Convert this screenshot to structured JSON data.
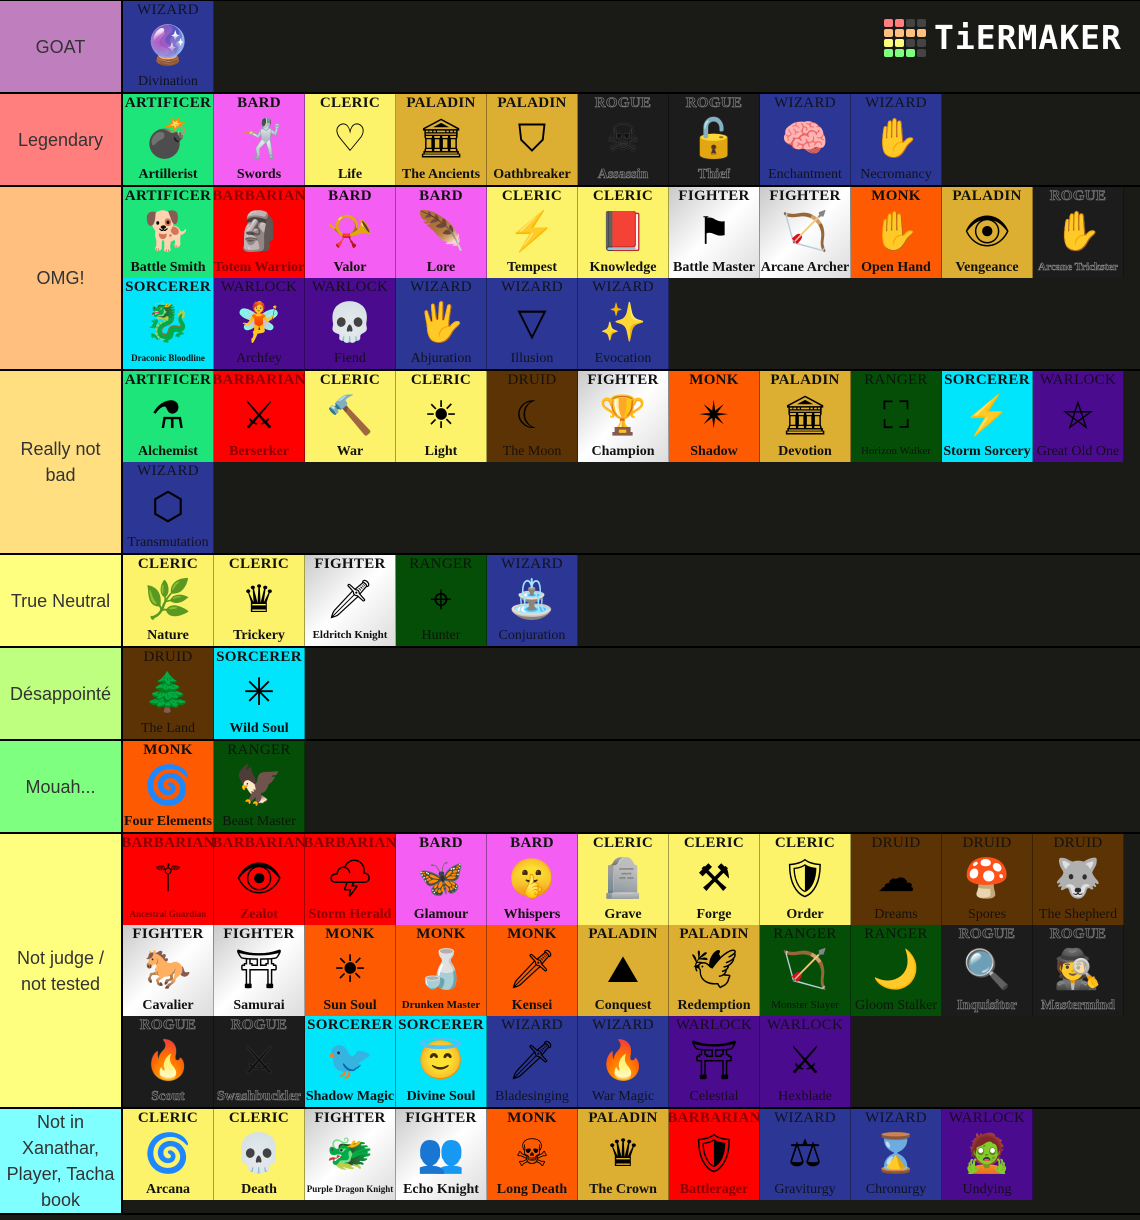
{
  "logo": {
    "text": "TiERMAKER",
    "grid_colors": [
      "#ff7f7f",
      "#ff7f7f",
      "#444",
      "#444",
      "#ffbf7f",
      "#ffbf7f",
      "#ffbf7f",
      "#ffbf7f",
      "#ffff7f",
      "#ffff7f",
      "#444",
      "#444",
      "#7fff7f",
      "#7fff7f",
      "#7fff7f",
      "#444"
    ]
  },
  "tiers": [
    {
      "label": "GOAT",
      "color": "#bf7fbf",
      "items": [
        {
          "class": "WIZARD",
          "sub": "Divination",
          "icon": "crystal-ball-icon",
          "glyph": "🔮"
        }
      ]
    },
    {
      "label": "Legendary",
      "color": "#ff7f7f",
      "items": [
        {
          "class": "ARTIFICER",
          "sub": "Artillerist",
          "icon": "cannon-icon",
          "glyph": "💣"
        },
        {
          "class": "BARD",
          "sub": "Swords",
          "icon": "rapier-icon",
          "glyph": "🤺"
        },
        {
          "class": "CLERIC",
          "sub": "Life",
          "icon": "heart-hands-icon",
          "glyph": "♡"
        },
        {
          "class": "PALADIN",
          "sub": "The Ancients",
          "icon": "pillar-icon",
          "glyph": "🏛"
        },
        {
          "class": "PALADIN",
          "sub": "Oathbreaker",
          "icon": "broken-shield-icon",
          "glyph": "⛉"
        },
        {
          "class": "ROGUE",
          "sub": "Assassin",
          "icon": "poison-bottle-icon",
          "glyph": "☠"
        },
        {
          "class": "ROGUE",
          "sub": "Thief",
          "icon": "broken-lock-icon",
          "glyph": "🔓"
        },
        {
          "class": "WIZARD",
          "sub": "Enchantment",
          "icon": "brain-head-icon",
          "glyph": "🧠"
        },
        {
          "class": "WIZARD",
          "sub": "Necromancy",
          "icon": "zombie-hand-icon",
          "glyph": "✋"
        }
      ]
    },
    {
      "label": "OMG!",
      "color": "#ffbf7f",
      "items": [
        {
          "class": "ARTIFICER",
          "sub": "Battle Smith",
          "icon": "steel-defender-icon",
          "glyph": "🐕"
        },
        {
          "class": "BARBARIAN",
          "sub": "Totem Warrior",
          "icon": "totem-icon",
          "glyph": "🗿"
        },
        {
          "class": "BARD",
          "sub": "Valor",
          "icon": "horn-icon",
          "glyph": "📯"
        },
        {
          "class": "BARD",
          "sub": "Lore",
          "icon": "quill-icon",
          "glyph": "🪶"
        },
        {
          "class": "CLERIC",
          "sub": "Tempest",
          "icon": "lightning-shield-icon",
          "glyph": "⚡"
        },
        {
          "class": "CLERIC",
          "sub": "Knowledge",
          "icon": "book-icon",
          "glyph": "📕"
        },
        {
          "class": "FIGHTER",
          "sub": "Battle Master",
          "icon": "banner-icon",
          "glyph": "⚑"
        },
        {
          "class": "FIGHTER",
          "sub": "Arcane Archer",
          "icon": "bow-icon",
          "glyph": "🏹"
        },
        {
          "class": "MONK",
          "sub": "Open Hand",
          "icon": "open-hand-icon",
          "glyph": "✋"
        },
        {
          "class": "PALADIN",
          "sub": "Vengeance",
          "icon": "burning-eye-icon",
          "glyph": "👁"
        },
        {
          "class": "ROGUE",
          "sub": "Arcane Trickster",
          "icon": "magic-hand-icon",
          "glyph": "✋"
        },
        {
          "class": "SORCERER",
          "sub": "Draconic Bloodline",
          "icon": "dragon-circle-icon",
          "glyph": "🐉"
        },
        {
          "class": "WARLOCK",
          "sub": "Archfey",
          "icon": "fairy-icon",
          "glyph": "🧚"
        },
        {
          "class": "WARLOCK",
          "sub": "Fiend",
          "icon": "flaming-skull-icon",
          "glyph": "💀"
        },
        {
          "class": "WIZARD",
          "sub": "Abjuration",
          "icon": "warding-hand-icon",
          "glyph": "🖐"
        },
        {
          "class": "WIZARD",
          "sub": "Illusion",
          "icon": "impossible-triangle-icon",
          "glyph": "▽"
        },
        {
          "class": "WIZARD",
          "sub": "Evocation",
          "icon": "swirl-magic-icon",
          "glyph": "✨"
        }
      ]
    },
    {
      "label": "Really not bad",
      "color": "#ffdf7f",
      "items": [
        {
          "class": "ARTIFICER",
          "sub": "Alchemist",
          "icon": "flask-icon",
          "glyph": "⚗"
        },
        {
          "class": "BARBARIAN",
          "sub": "Berserker",
          "icon": "crossed-axes-icon",
          "glyph": "⚔"
        },
        {
          "class": "CLERIC",
          "sub": "War",
          "icon": "warhammer-icon",
          "glyph": "🔨"
        },
        {
          "class": "CLERIC",
          "sub": "Light",
          "icon": "sun-icon",
          "glyph": "☀"
        },
        {
          "class": "DRUID",
          "sub": "The Moon",
          "icon": "crescent-moon-icon",
          "glyph": "☾"
        },
        {
          "class": "FIGHTER",
          "sub": "Champion",
          "icon": "trophy-icon",
          "glyph": "🏆"
        },
        {
          "class": "MONK",
          "sub": "Shadow",
          "icon": "shuriken-icon",
          "glyph": "✴"
        },
        {
          "class": "PALADIN",
          "sub": "Devotion",
          "icon": "temple-icon",
          "glyph": "🏛"
        },
        {
          "class": "RANGER",
          "sub": "Horizon Walker",
          "icon": "portal-ring-icon",
          "glyph": "⛶"
        },
        {
          "class": "SORCERER",
          "sub": "Storm Sorcery",
          "icon": "lightning-icon",
          "glyph": "⚡"
        },
        {
          "class": "WARLOCK",
          "sub": "Great Old One",
          "icon": "elder-sign-icon",
          "glyph": "⛤"
        },
        {
          "class": "WIZARD",
          "sub": "Transmutation",
          "icon": "gem-icon",
          "glyph": "⬡"
        }
      ]
    },
    {
      "label": "True Neutral",
      "color": "#ffff7f",
      "items": [
        {
          "class": "CLERIC",
          "sub": "Nature",
          "icon": "leaves-icon",
          "glyph": "🌿"
        },
        {
          "class": "CLERIC",
          "sub": "Trickery",
          "icon": "jester-crown-icon",
          "glyph": "♛"
        },
        {
          "class": "FIGHTER",
          "sub": "Eldritch Knight",
          "icon": "flaming-sword-icon",
          "glyph": "🗡"
        },
        {
          "class": "RANGER",
          "sub": "Hunter",
          "icon": "crosshair-icon",
          "glyph": "⌖"
        },
        {
          "class": "WIZARD",
          "sub": "Conjuration",
          "icon": "summoning-circle-icon",
          "glyph": "⛲"
        }
      ]
    },
    {
      "label": "Désappointé",
      "color": "#bfff7f",
      "items": [
        {
          "class": "DRUID",
          "sub": "The Land",
          "icon": "forest-island-icon",
          "glyph": "🌲"
        },
        {
          "class": "SORCERER",
          "sub": "Wild Soul",
          "icon": "chaos-star-icon",
          "glyph": "✳"
        }
      ]
    },
    {
      "label": "Mouah...",
      "color": "#7fff7f",
      "items": [
        {
          "class": "MONK",
          "sub": "Four Elements",
          "icon": "elemental-swirl-icon",
          "glyph": "🌀"
        },
        {
          "class": "RANGER",
          "sub": "Beast Master",
          "icon": "bird-claw-icon",
          "glyph": "🦅"
        }
      ]
    },
    {
      "label": "Not judge / not tested",
      "color": "#ffff7f",
      "items": [
        {
          "class": "BARBARIAN",
          "sub": "Ancestral Guardian",
          "icon": "ancestor-spirits-icon",
          "glyph": "⚚"
        },
        {
          "class": "BARBARIAN",
          "sub": "Zealot",
          "icon": "radiant-eye-icon",
          "glyph": "👁"
        },
        {
          "class": "BARBARIAN",
          "sub": "Storm Herald",
          "icon": "storm-cloud-icon",
          "glyph": "🌩"
        },
        {
          "class": "BARD",
          "sub": "Glamour",
          "icon": "butterfly-icon",
          "glyph": "🦋"
        },
        {
          "class": "BARD",
          "sub": "Whispers",
          "icon": "whisper-hand-icon",
          "glyph": "🤫"
        },
        {
          "class": "CLERIC",
          "sub": "Grave",
          "icon": "tombstone-icon",
          "glyph": "🪦"
        },
        {
          "class": "CLERIC",
          "sub": "Forge",
          "icon": "anvil-icon",
          "glyph": "⚒"
        },
        {
          "class": "CLERIC",
          "sub": "Order",
          "icon": "order-shield-icon",
          "glyph": "🛡"
        },
        {
          "class": "DRUID",
          "sub": "Dreams",
          "icon": "thought-cloud-icon",
          "glyph": "☁"
        },
        {
          "class": "DRUID",
          "sub": "Spores",
          "icon": "mushroom-icon",
          "glyph": "🍄"
        },
        {
          "class": "DRUID",
          "sub": "The Shepherd",
          "icon": "wolf-head-icon",
          "glyph": "🐺"
        },
        {
          "class": "FIGHTER",
          "sub": "Cavalier",
          "icon": "saddle-icon",
          "glyph": "🐎"
        },
        {
          "class": "FIGHTER",
          "sub": "Samurai",
          "icon": "samurai-armor-icon",
          "glyph": "⛩"
        },
        {
          "class": "MONK",
          "sub": "Sun Soul",
          "icon": "sun-burst-icon",
          "glyph": "☀"
        },
        {
          "class": "MONK",
          "sub": "Drunken Master",
          "icon": "jug-icon",
          "glyph": "🍶"
        },
        {
          "class": "MONK",
          "sub": "Kensei",
          "icon": "spear-icon",
          "glyph": "🗡"
        },
        {
          "class": "PALADIN",
          "sub": "Conquest",
          "icon": "flag-mountain-icon",
          "glyph": "⛰"
        },
        {
          "class": "PALADIN",
          "sub": "Redemption",
          "icon": "dove-icon",
          "glyph": "🕊"
        },
        {
          "class": "RANGER",
          "sub": "Monster Slayer",
          "icon": "crossbow-icon",
          "glyph": "🏹"
        },
        {
          "class": "RANGER",
          "sub": "Gloom Stalker",
          "icon": "moon-cloud-icon",
          "glyph": "🌙"
        },
        {
          "class": "ROGUE",
          "sub": "Inquisitor",
          "icon": "magnifying-glass-icon",
          "glyph": "🔍"
        },
        {
          "class": "ROGUE",
          "sub": "Mastermind",
          "icon": "spy-icon",
          "glyph": "🕵"
        },
        {
          "class": "ROGUE",
          "sub": "Scout",
          "icon": "campfire-icon",
          "glyph": "🔥"
        },
        {
          "class": "ROGUE",
          "sub": "Swashbuckler",
          "icon": "scimitar-icon",
          "glyph": "⚔"
        },
        {
          "class": "SORCERER",
          "sub": "Shadow Magic",
          "icon": "raven-icon",
          "glyph": "🐦"
        },
        {
          "class": "SORCERER",
          "sub": "Divine Soul",
          "icon": "angel-wings-icon",
          "glyph": "😇"
        },
        {
          "class": "WIZARD",
          "sub": "Bladesinging",
          "icon": "sword-icon",
          "glyph": "🗡"
        },
        {
          "class": "WIZARD",
          "sub": "War Magic",
          "icon": "arcane-flame-icon",
          "glyph": "🔥"
        },
        {
          "class": "WARLOCK",
          "sub": "Celestial",
          "icon": "celestial-gate-icon",
          "glyph": "⛩"
        },
        {
          "class": "WARLOCK",
          "sub": "Hexblade",
          "icon": "crossed-swords-icon",
          "glyph": "⚔"
        }
      ]
    },
    {
      "label": "Not in Xanathar, Player, Tacha book",
      "color": "#7fffff",
      "items": [
        {
          "class": "CLERIC",
          "sub": "Arcana",
          "icon": "spiral-icon",
          "glyph": "🌀"
        },
        {
          "class": "CLERIC",
          "sub": "Death",
          "icon": "flaming-skull-icon",
          "glyph": "💀"
        },
        {
          "class": "FIGHTER",
          "sub": "Purple Dragon Knight",
          "icon": "dragon-head-icon",
          "glyph": "🐲"
        },
        {
          "class": "FIGHTER",
          "sub": "Echo Knight",
          "icon": "echo-figures-icon",
          "glyph": "👥"
        },
        {
          "class": "MONK",
          "sub": "Long Death",
          "icon": "skull-splat-icon",
          "glyph": "☠"
        },
        {
          "class": "PALADIN",
          "sub": "The Crown",
          "icon": "crown-icon",
          "glyph": "♛"
        },
        {
          "class": "BARBARIAN",
          "sub": "Battlerager",
          "icon": "spiked-shield-icon",
          "glyph": "🛡"
        },
        {
          "class": "WIZARD",
          "sub": "Graviturgy",
          "icon": "weight-icon",
          "glyph": "⚖"
        },
        {
          "class": "WIZARD",
          "sub": "Chronurgy",
          "icon": "hourglass-icon",
          "glyph": "⌛"
        },
        {
          "class": "WARLOCK",
          "sub": "Undying",
          "icon": "undead-head-icon",
          "glyph": "🧟"
        }
      ]
    }
  ]
}
